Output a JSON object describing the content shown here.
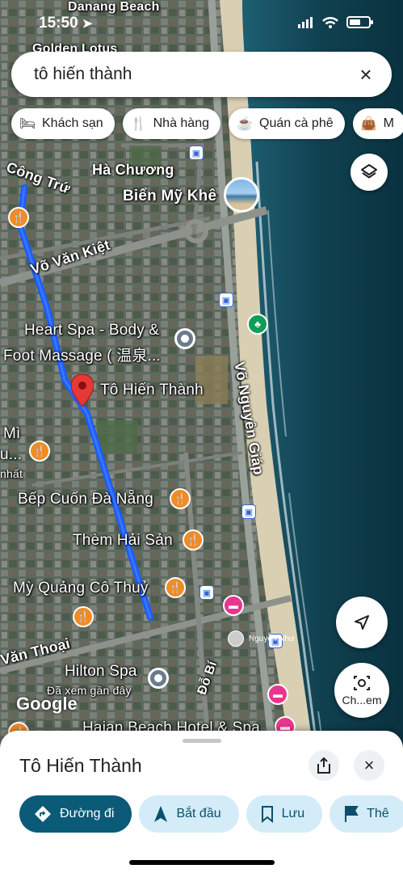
{
  "status_bar": {
    "time": "15:50"
  },
  "search": {
    "query": "tô hiến thành"
  },
  "chips": [
    {
      "label": "Khách sạn",
      "icon": "bed-icon"
    },
    {
      "label": "Nhà hàng",
      "icon": "fork-knife-icon"
    },
    {
      "label": "Quán cà phê",
      "icon": "coffee-cup-icon"
    },
    {
      "label": "M",
      "icon": "shopping-bag-icon"
    }
  ],
  "map": {
    "labels": {
      "ha_chuong": "Hà Chương",
      "bien_my_khe": "Biển Mỹ Khê",
      "con_tru": "Công Trứ",
      "vo_van_kiet": "Võ Văn Kiệt",
      "heart_spa_1": "Heart Spa - Body &",
      "heart_spa_2": "Foot Massage ( 温泉...",
      "to_hien_thanh": "Tô Hiến Thành",
      "vo_nguyen_giap": "Võ Nguyên Giáp",
      "bep_cuon": "Bếp Cuốn Đà Nẵng",
      "them_hai_san": "Thèm Hải Sản",
      "my_quang": "Mỳ Quảng Cô Thuỷ",
      "van_thoai": "Văn Thoại",
      "hilton_spa": "Hilton Spa",
      "da_xem": "Đã xem gần đây",
      "do_bi": "Đỗ Bí",
      "haian": "Haian Beach Hotel & Spa",
      "mi": "Mì",
      "mi_sub": "u...",
      "nhat": "nhất",
      "top_cut": "Golden Lotus",
      "top_beach": "Danang Beach"
    },
    "google_logo": "Google",
    "user_name": "Nguyễn Như",
    "lens_label": "Ch...em"
  },
  "sheet": {
    "title": "Tô Hiến Thành",
    "actions": [
      {
        "label": "Đường đi",
        "icon": "directions-icon",
        "primary": true
      },
      {
        "label": "Bắt đầu",
        "icon": "navigation-arrow-icon",
        "primary": false
      },
      {
        "label": "Lưu",
        "icon": "bookmark-icon",
        "primary": false
      },
      {
        "label": "Thê",
        "icon": "flag-icon",
        "primary": false
      }
    ]
  },
  "colors": {
    "route": "#1a5cff",
    "primary_action": "#0b5a78",
    "secondary_action": "#d3ecf7",
    "food_pin": "#f28b25",
    "hotel_pin": "#e8368f",
    "pin_red": "#e53935"
  }
}
